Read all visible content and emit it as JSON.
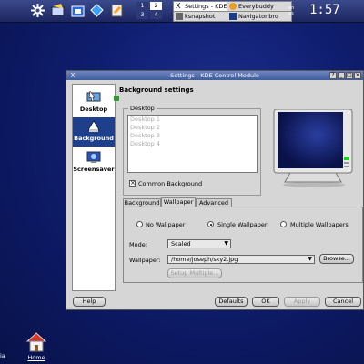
{
  "panel": {
    "icons": [
      "kde-gear-icon",
      "konqueror-shell-icon",
      "home-folder-icon",
      "kcontrol-icon",
      "kate-editor-icon"
    ],
    "pager": [
      "1",
      "2",
      "3",
      "4"
    ],
    "tasks": [
      {
        "label": "Settings - KDE",
        "active": true
      },
      {
        "label": "Everybuddy",
        "active": false
      },
      {
        "label": "ksnapshot",
        "active": false
      },
      {
        "label": "Navigator.bro",
        "active": false
      }
    ],
    "clock": "1:57"
  },
  "window": {
    "title": "Settings - KDE Control Module",
    "sidebar": [
      {
        "label": "Desktop",
        "icon": "desktop-pointer-icon"
      },
      {
        "label": "Background",
        "icon": "background-icon",
        "active": true
      },
      {
        "label": "Screensaver",
        "icon": "screensaver-icon"
      }
    ],
    "heading": "Background settings",
    "desktop_group": {
      "title": "Desktop",
      "items": [
        "Desktop 1",
        "Desktop 2",
        "Desktop 3",
        "Desktop 4"
      ],
      "common_background_label": "Common Background",
      "common_background_checked": true
    },
    "tabs": [
      "Background",
      "Wallpaper",
      "Advanced"
    ],
    "active_tab": "Wallpaper",
    "wallpaper": {
      "radios": [
        {
          "label": "No Wallpaper",
          "selected": false
        },
        {
          "label": "Single Wallpaper",
          "selected": true
        },
        {
          "label": "Multiple Wallpapers",
          "selected": false
        }
      ],
      "mode_label": "Mode:",
      "mode_value": "Scaled",
      "wallpaper_label": "Wallpaper:",
      "wallpaper_value": "/home/joseph/sky2.jpg",
      "browse_label": "Browse...",
      "setup_multiple_label": "Setup Multiple..."
    },
    "buttons": {
      "help": "Help",
      "defaults": "Defaults",
      "ok": "OK",
      "apply": "Apply",
      "cancel": "Cancel"
    }
  },
  "desktop_icons": [
    {
      "label": "Home",
      "icon": "home-icon"
    }
  ],
  "edge_text": "ia"
}
